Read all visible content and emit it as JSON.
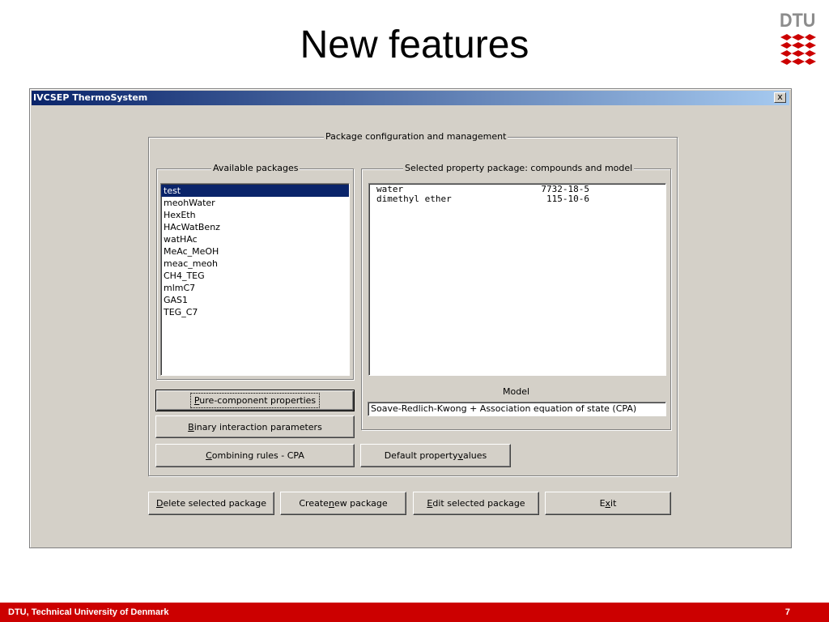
{
  "slide": {
    "title": "New features",
    "logo_text": "DTU",
    "footer_left": "DTU, Technical University of Denmark",
    "page_number": "7"
  },
  "window": {
    "title": "IVCSEP ThermoSystem",
    "close_label": "x"
  },
  "config_group": {
    "label": "Package configuration and management"
  },
  "available": {
    "label": "Available packages",
    "items": [
      "test",
      "meohWater",
      "HexEth",
      "HAcWatBenz",
      "watHAc",
      "MeAc_MeOH",
      "meac_meoh",
      "CH4_TEG",
      "mlmC7",
      "GAS1",
      "TEG_C7"
    ],
    "selected_index": 0
  },
  "selected": {
    "label": "Selected property package: compounds and model",
    "compounds": [
      {
        "name": "water",
        "cas": "7732-18-5"
      },
      {
        "name": "dimethyl ether",
        "cas": "115-10-6"
      }
    ],
    "model_label": "Model",
    "model_value": "Soave-Redlich-Kwong + Association equation of state (CPA)"
  },
  "buttons": {
    "pure_component": {
      "pre": "",
      "accel": "P",
      "post": "ure-component properties"
    },
    "binary": {
      "pre": "",
      "accel": "B",
      "post": "inary interaction parameters"
    },
    "combining": {
      "pre": "",
      "accel": "C",
      "post": "ombining rules - CPA"
    },
    "default_values": {
      "pre": "Default property ",
      "accel": "v",
      "post": "alues"
    },
    "delete": {
      "pre": "",
      "accel": "D",
      "post": "elete selected package"
    },
    "create": {
      "pre": "Create ",
      "accel": "n",
      "post": "ew package"
    },
    "edit": {
      "pre": "",
      "accel": "E",
      "post": "dit selected package"
    },
    "exit": {
      "pre": "E",
      "accel": "x",
      "post": "it"
    }
  },
  "colors": {
    "footer": "#cc0000",
    "window_bg": "#d4d0c8",
    "selection": "#0a246a",
    "titlebar_start": "#0a246a",
    "titlebar_end": "#a6caf0",
    "logo_red": "#cc0000",
    "logo_gray": "#8c8c8c"
  }
}
